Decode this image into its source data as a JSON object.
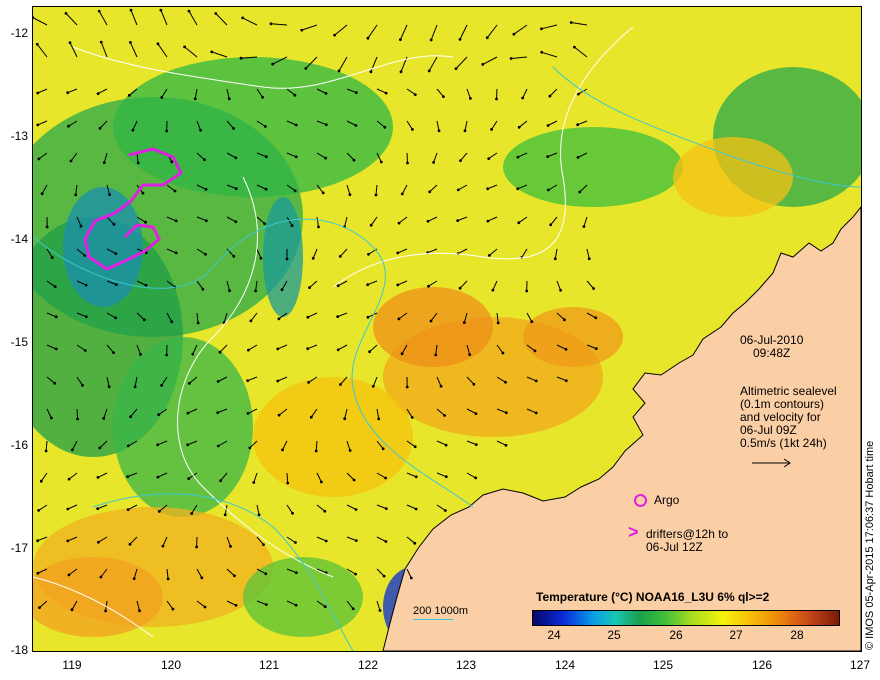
{
  "map": {
    "lat_ticks": [
      "-12",
      "-13",
      "-14",
      "-15",
      "-16",
      "-17",
      "-18"
    ],
    "lon_ticks": [
      "119",
      "120",
      "121",
      "122",
      "123",
      "124",
      "125",
      "126",
      "127"
    ],
    "lat_range": [
      -18,
      -11.75
    ],
    "lon_range": [
      118.6,
      127.0
    ],
    "land_color": "#fbcfa6",
    "colors": {
      "argo_marker": "#e020e0",
      "drifter_track": "#e020e0",
      "contour": "#ffffff",
      "depth_contour": "#3cc8d0"
    },
    "drifter_track": "loop near 119.3–119.8 E, 13.1–14.3 S"
  },
  "annotations": {
    "date": "06-Jul-2010",
    "time": "09:48Z",
    "alt_line1": "Altimetric sealevel",
    "alt_line2": "(0.1m contours)",
    "alt_line3": "and velocity for",
    "alt_line4": "06-Jul 09Z",
    "alt_line5": "0.5m/s (1kt 24h)",
    "argo": "Argo",
    "drifter_line1": "drifters@12h to",
    "drifter_line2": "06-Jul 12Z",
    "depth_legend": "200  1000m"
  },
  "colorbar": {
    "title": "Temperature (°C) NOAA16_L3U 6% ql>=2",
    "ticks": [
      "24",
      "25",
      "26",
      "27",
      "28"
    ],
    "range": [
      23.6,
      28.8
    ]
  },
  "credit": "© IMOS 05-Apr-2015 17:06:37 Hobart time"
}
